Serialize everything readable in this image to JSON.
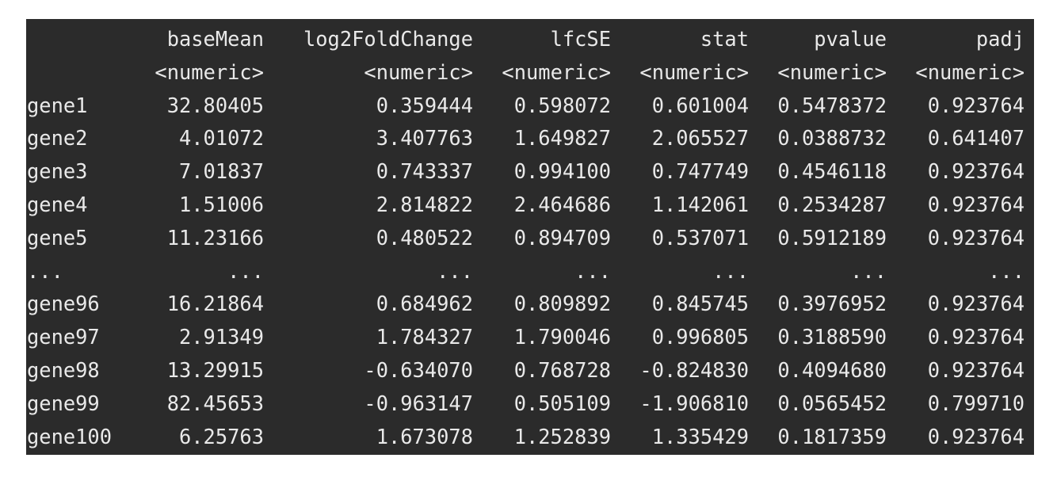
{
  "results_table": {
    "columns": [
      "",
      "baseMean",
      "log2FoldChange",
      "lfcSE",
      "stat",
      "pvalue",
      "padj"
    ],
    "types": [
      "",
      "<numeric>",
      "<numeric>",
      "<numeric>",
      "<numeric>",
      "<numeric>",
      "<numeric>"
    ],
    "rows": [
      [
        "gene1",
        "32.80405",
        "0.359444",
        "0.598072",
        "0.601004",
        "0.5478372",
        "0.923764"
      ],
      [
        "gene2",
        "4.01072",
        "3.407763",
        "1.649827",
        "2.065527",
        "0.0388732",
        "0.641407"
      ],
      [
        "gene3",
        "7.01837",
        "0.743337",
        "0.994100",
        "0.747749",
        "0.4546118",
        "0.923764"
      ],
      [
        "gene4",
        "1.51006",
        "2.814822",
        "2.464686",
        "1.142061",
        "0.2534287",
        "0.923764"
      ],
      [
        "gene5",
        "11.23166",
        "0.480522",
        "0.894709",
        "0.537071",
        "0.5912189",
        "0.923764"
      ],
      [
        "...",
        "...",
        "...",
        "...",
        "...",
        "...",
        "..."
      ],
      [
        "gene96",
        "16.21864",
        "0.684962",
        "0.809892",
        "0.845745",
        "0.3976952",
        "0.923764"
      ],
      [
        "gene97",
        "2.91349",
        "1.784327",
        "1.790046",
        "0.996805",
        "0.3188590",
        "0.923764"
      ],
      [
        "gene98",
        "13.29915",
        "-0.634070",
        "0.768728",
        "-0.824830",
        "0.4094680",
        "0.923764"
      ],
      [
        "gene99",
        "82.45653",
        "-0.963147",
        "0.505109",
        "-1.906810",
        "0.0565452",
        "0.799710"
      ],
      [
        "gene100",
        "6.25763",
        "1.673078",
        "1.252839",
        "1.335429",
        "0.1817359",
        "0.923764"
      ]
    ]
  },
  "colors": {
    "background": "#2b2b2b",
    "text": "#e9e9e9",
    "page": "#ffffff"
  }
}
